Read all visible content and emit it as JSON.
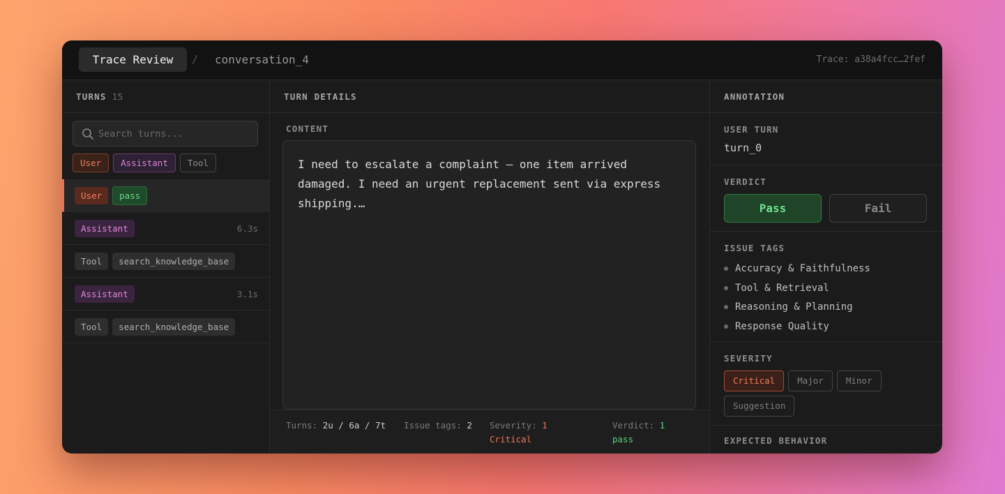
{
  "header": {
    "title": "Trace Review",
    "separator": "/",
    "conversation": "conversation_4",
    "trace_id": "Trace: a38a4fcc…2fef"
  },
  "turns_panel": {
    "heading": "TURNS",
    "count": "15",
    "search_placeholder": "Search turns...",
    "filters": [
      "User",
      "Assistant",
      "Tool"
    ],
    "items": [
      {
        "role": "User",
        "status": "pass",
        "duration": ""
      },
      {
        "role": "Assistant",
        "status": "",
        "duration": "6.3s"
      },
      {
        "role": "Tool",
        "name": "search_knowledge_base"
      },
      {
        "role": "Assistant",
        "status": "",
        "duration": "3.1s"
      },
      {
        "role": "Tool",
        "name": "search_knowledge_base"
      }
    ]
  },
  "details_panel": {
    "heading": "TURN DETAILS",
    "content_label": "CONTENT",
    "content_text": "I need to escalate a complaint — one item arrived damaged. I need an urgent replacement sent via express shipping.…",
    "stats": {
      "turns_label": "Turns:",
      "turns_value": "2u / 6a / 7t",
      "issue_label": "Issue tags:",
      "issue_value": "2",
      "severity_label": "Severity:",
      "severity_value": "1 Critical",
      "verdict_label": "Verdict:",
      "verdict_value": "1 pass"
    }
  },
  "annotation_panel": {
    "heading": "ANNOTATION",
    "user_turn_label": "USER TURN",
    "user_turn_value": "turn_0",
    "verdict_label": "VERDICT",
    "pass_label": "Pass",
    "fail_label": "Fail",
    "issue_tags_label": "ISSUE TAGS",
    "issue_tags": [
      "Accuracy & Faithfulness",
      "Tool & Retrieval",
      "Reasoning & Planning",
      "Response Quality"
    ],
    "severity_label": "SEVERITY",
    "severity_options": [
      "Critical",
      "Major",
      "Minor",
      "Suggestion"
    ],
    "expected_label": "EXPECTED BEHAVIOR"
  },
  "colors": {
    "accent_user": "#f0805c",
    "accent_assistant": "#e387d6",
    "accent_pass": "#6fe08f"
  }
}
